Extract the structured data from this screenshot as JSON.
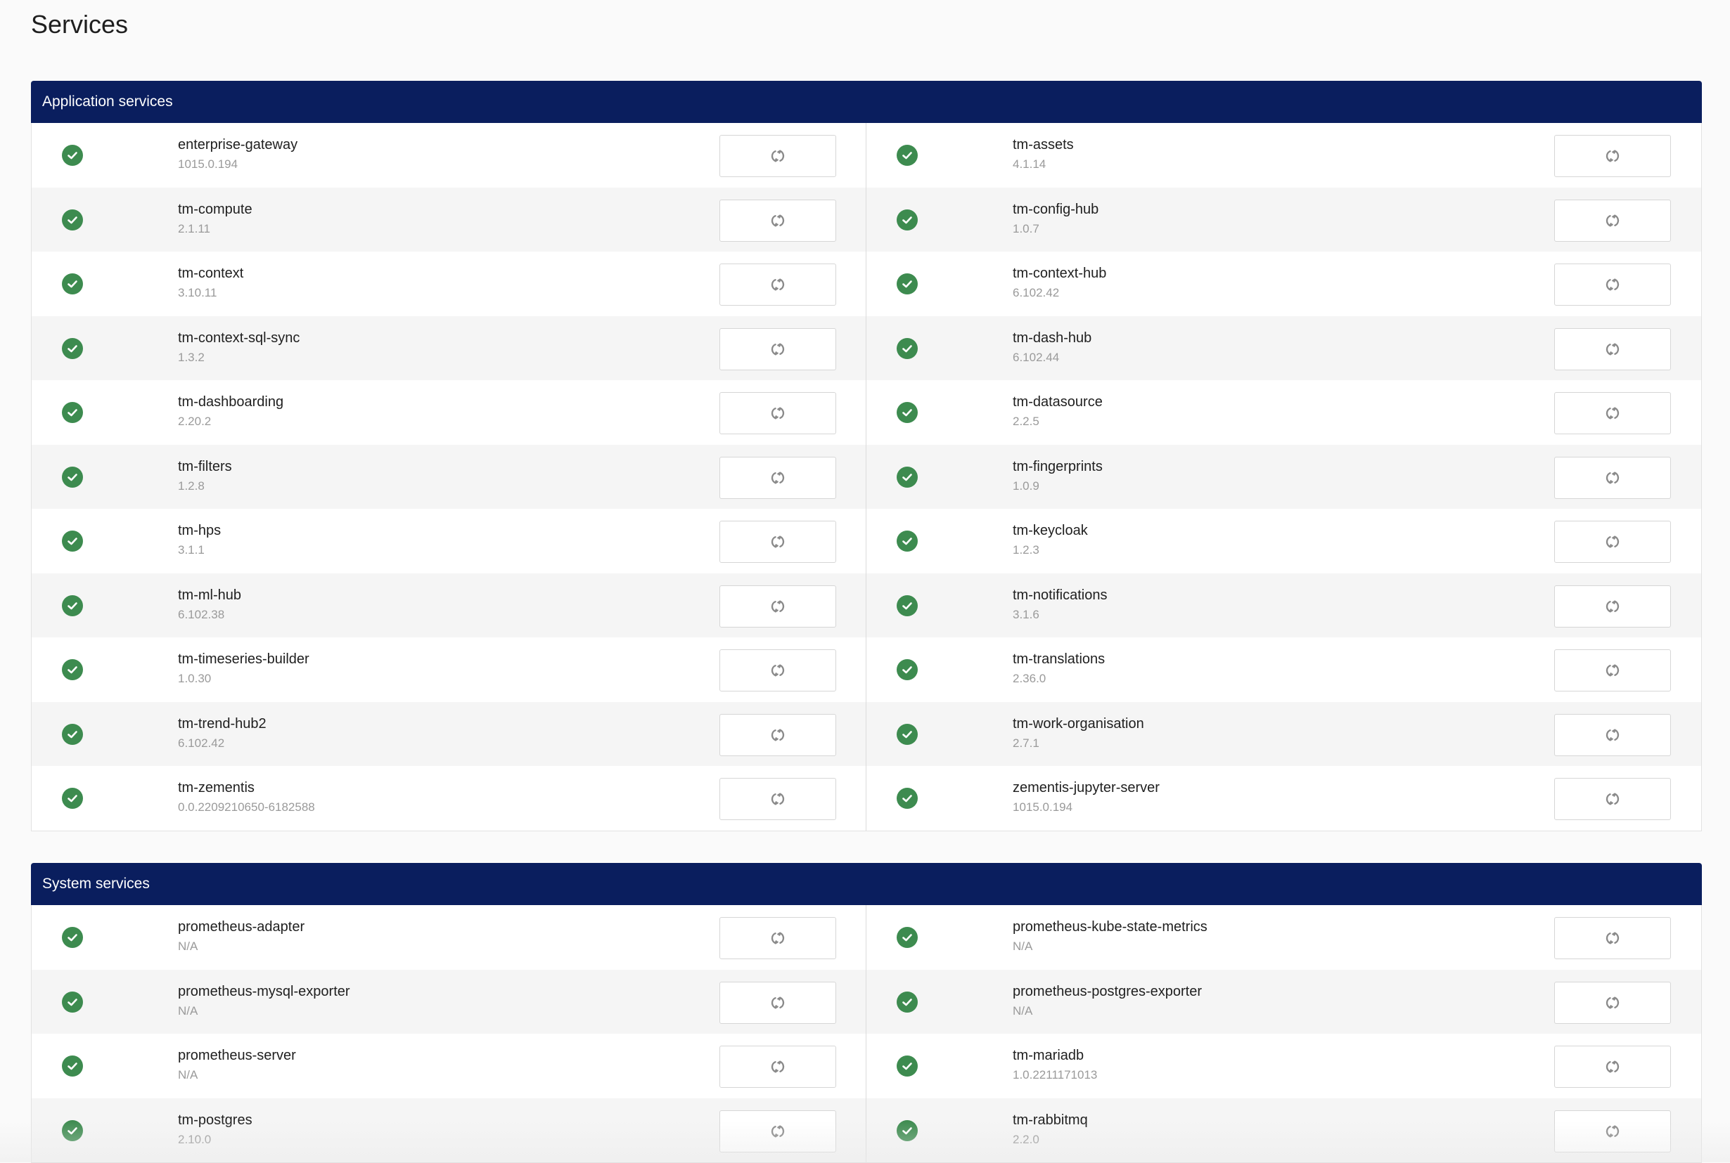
{
  "page": {
    "title": "Services"
  },
  "colors": {
    "header_bg": "#0a1e5e",
    "status_ok": "#3d8b4f",
    "row_stripe": "#f5f5f5"
  },
  "icons": {
    "status": "check-circle-icon",
    "restart": "refresh-icon"
  },
  "application_services": {
    "title": "Application services",
    "left": [
      {
        "name": "enterprise-gateway",
        "version": "1015.0.194",
        "status": "ok"
      },
      {
        "name": "tm-compute",
        "version": "2.1.11",
        "status": "ok"
      },
      {
        "name": "tm-context",
        "version": "3.10.11",
        "status": "ok"
      },
      {
        "name": "tm-context-sql-sync",
        "version": "1.3.2",
        "status": "ok"
      },
      {
        "name": "tm-dashboarding",
        "version": "2.20.2",
        "status": "ok"
      },
      {
        "name": "tm-filters",
        "version": "1.2.8",
        "status": "ok"
      },
      {
        "name": "tm-hps",
        "version": "3.1.1",
        "status": "ok"
      },
      {
        "name": "tm-ml-hub",
        "version": "6.102.38",
        "status": "ok"
      },
      {
        "name": "tm-timeseries-builder",
        "version": "1.0.30",
        "status": "ok"
      },
      {
        "name": "tm-trend-hub2",
        "version": "6.102.42",
        "status": "ok"
      },
      {
        "name": "tm-zementis",
        "version": "0.0.2209210650-6182588",
        "status": "ok"
      }
    ],
    "right": [
      {
        "name": "tm-assets",
        "version": "4.1.14",
        "status": "ok"
      },
      {
        "name": "tm-config-hub",
        "version": "1.0.7",
        "status": "ok"
      },
      {
        "name": "tm-context-hub",
        "version": "6.102.42",
        "status": "ok"
      },
      {
        "name": "tm-dash-hub",
        "version": "6.102.44",
        "status": "ok"
      },
      {
        "name": "tm-datasource",
        "version": "2.2.5",
        "status": "ok"
      },
      {
        "name": "tm-fingerprints",
        "version": "1.0.9",
        "status": "ok"
      },
      {
        "name": "tm-keycloak",
        "version": "1.2.3",
        "status": "ok"
      },
      {
        "name": "tm-notifications",
        "version": "3.1.6",
        "status": "ok"
      },
      {
        "name": "tm-translations",
        "version": "2.36.0",
        "status": "ok"
      },
      {
        "name": "tm-work-organisation",
        "version": "2.7.1",
        "status": "ok"
      },
      {
        "name": "zementis-jupyter-server",
        "version": "1015.0.194",
        "status": "ok"
      }
    ]
  },
  "system_services": {
    "title": "System services",
    "left": [
      {
        "name": "prometheus-adapter",
        "version": "N/A",
        "status": "ok"
      },
      {
        "name": "prometheus-mysql-exporter",
        "version": "N/A",
        "status": "ok"
      },
      {
        "name": "prometheus-server",
        "version": "N/A",
        "status": "ok"
      },
      {
        "name": "tm-postgres",
        "version": "2.10.0",
        "status": "ok"
      }
    ],
    "right": [
      {
        "name": "prometheus-kube-state-metrics",
        "version": "N/A",
        "status": "ok"
      },
      {
        "name": "prometheus-postgres-exporter",
        "version": "N/A",
        "status": "ok"
      },
      {
        "name": "tm-mariadb",
        "version": "1.0.2211171013",
        "status": "ok"
      },
      {
        "name": "tm-rabbitmq",
        "version": "2.2.0",
        "status": "ok"
      }
    ]
  }
}
